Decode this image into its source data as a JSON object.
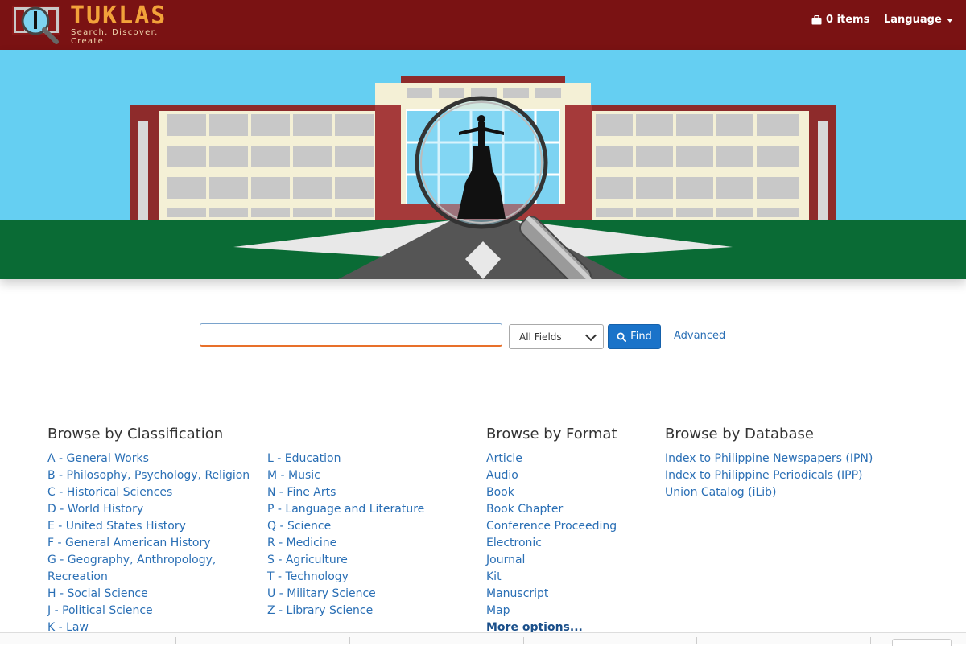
{
  "header": {
    "brand": "TUKLAS",
    "tagline": "Search. Discover. Create.",
    "cart_label": "0 items",
    "language_label": "Language"
  },
  "search": {
    "value": "",
    "placeholder": "",
    "field_selected": "All Fields",
    "find_label": "Find",
    "advanced_label": "Advanced"
  },
  "browse_classification": {
    "heading": "Browse by Classification",
    "col1": [
      "A - General Works",
      "B - Philosophy, Psychology, Religion",
      "C - Historical Sciences",
      "D - World History",
      "E - United States History",
      "F - General American History",
      "G - Geography, Anthropology, Recreation",
      "H - Social Science",
      "J - Political Science",
      "K - Law"
    ],
    "col2": [
      "L - Education",
      "M - Music",
      "N - Fine Arts",
      "P - Language and Literature",
      "Q - Science",
      "R - Medicine",
      "S - Agriculture",
      "T - Technology",
      "U - Military Science",
      "Z - Library Science"
    ]
  },
  "browse_format": {
    "heading": "Browse by Format",
    "items": [
      "Article",
      "Audio",
      "Book",
      "Book Chapter",
      "Conference Proceeding",
      "Electronic",
      "Journal",
      "Kit",
      "Manuscript",
      "Map"
    ],
    "more_label": "More options..."
  },
  "browse_database": {
    "heading": "Browse by Database",
    "items": [
      "Index to Philippine Newspapers (IPN)",
      "Index to Philippine Periodicals (IPP)",
      "Union Catalog (iLib)"
    ]
  },
  "colors": {
    "header_bg": "#7a1213",
    "brand_text": "#f2a23a",
    "link": "#2a6fb5",
    "button": "#1a73c9",
    "sky": "#65cff2",
    "grass": "#0a6b35"
  }
}
